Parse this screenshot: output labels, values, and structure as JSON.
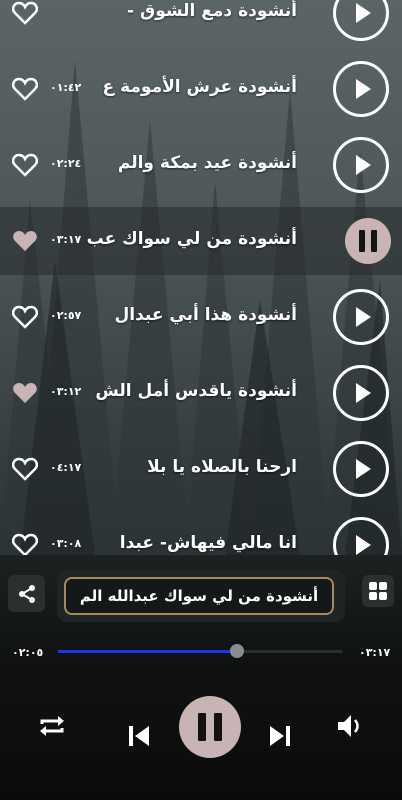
{
  "tracks": [
    {
      "title": "أنشودة دمع الشوق -",
      "duration": "",
      "liked": false,
      "active": false
    },
    {
      "title": "أنشودة عرش الأمومة ع",
      "duration": "٠١:٤٢",
      "liked": false,
      "active": false
    },
    {
      "title": "أنشودة عيد بمكة والم",
      "duration": "٠٢:٢٤",
      "liked": false,
      "active": false
    },
    {
      "title": "أنشودة من لي سواك عب",
      "duration": "٠٣:١٧",
      "liked": true,
      "active": true
    },
    {
      "title": "أنشودة هذا أبي عبدال",
      "duration": "٠٢:٥٧",
      "liked": false,
      "active": false
    },
    {
      "title": "أنشودة ياقدس أمل الش",
      "duration": "٠٣:١٢",
      "liked": true,
      "active": false
    },
    {
      "title": "ارحنا بالصلاه يا بلا",
      "duration": "٠٤:١٧",
      "liked": false,
      "active": false
    },
    {
      "title": "انا مالي فيهاش- عبدا",
      "duration": "٠٣:٠٨",
      "liked": false,
      "active": false
    }
  ],
  "player": {
    "now_playing": "أنشودة من لي سواك عبدالله الم",
    "elapsed": "٠٢:٠٥",
    "total": "٠٣:١٧",
    "progress": 0.63
  },
  "colors": {
    "accent_blue": "#1c38ee",
    "pause_pink": "#c8b4b4",
    "gold_border": "#a8895c",
    "liked_heart": "#c8b4b4"
  },
  "icons": {
    "share": "share-icon",
    "grid": "grid-icon",
    "repeat": "repeat-icon",
    "prev": "skip-previous-icon",
    "next": "skip-next-icon",
    "volume": "volume-icon"
  }
}
